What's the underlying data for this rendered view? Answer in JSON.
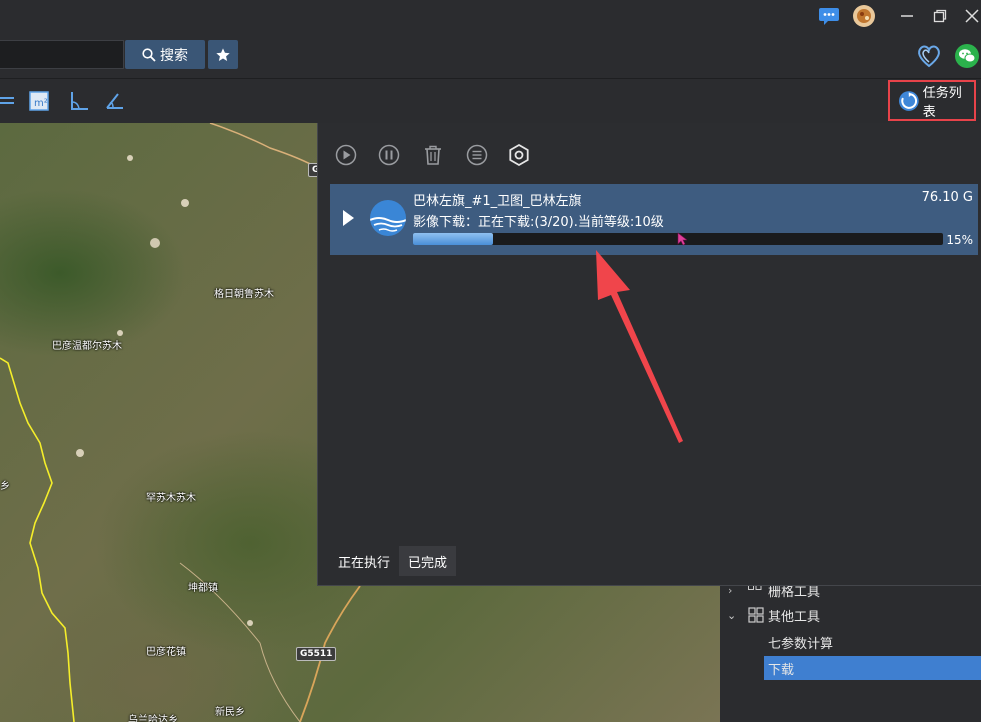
{
  "titlebar": {
    "icons": [
      "chat-icon",
      "avatar",
      "minimize-icon",
      "restore-icon",
      "close-icon"
    ]
  },
  "toolbar": {
    "search_placeholder": "",
    "search_label": "搜索",
    "right_icons": [
      "heart-logo-icon",
      "wechat-icon"
    ]
  },
  "tools": {
    "icons": [
      "line-tool-icon",
      "area-tool-icon",
      "angle-tool-icon",
      "measure-tool-icon"
    ],
    "task_list_label": "任务列表",
    "accent": "#e8434a"
  },
  "map": {
    "labels": [
      {
        "text": "格日朝鲁苏木"
      },
      {
        "text": "巴彦温都尔苏木"
      },
      {
        "text": "罕苏木苏木"
      },
      {
        "text": "坤都镇"
      },
      {
        "text": "巴彦花镇"
      },
      {
        "text": "新民乡"
      },
      {
        "text": "乌兰哈达乡"
      },
      {
        "text": "乡"
      }
    ],
    "road_badge": "G5511",
    "road_badge_top": "G"
  },
  "task_panel": {
    "controls": [
      "play-all-icon",
      "pause-all-icon",
      "delete-icon",
      "list-icon",
      "settings-icon"
    ],
    "task": {
      "name": "巴林左旗_#1_卫图_巴林左旗",
      "size": "76.10 G",
      "status": "影像下载：正在下载:(3/20).当前等级:10级",
      "progress": 0.15,
      "progress_label": "15%"
    },
    "tabs": [
      "正在执行",
      "已完成"
    ]
  },
  "tree": {
    "items": [
      {
        "label": "栅格工具"
      },
      {
        "label": "其他工具"
      },
      {
        "label": "七参数计算"
      },
      {
        "label": "下载"
      }
    ],
    "selected_color": "#3f7fd0"
  }
}
